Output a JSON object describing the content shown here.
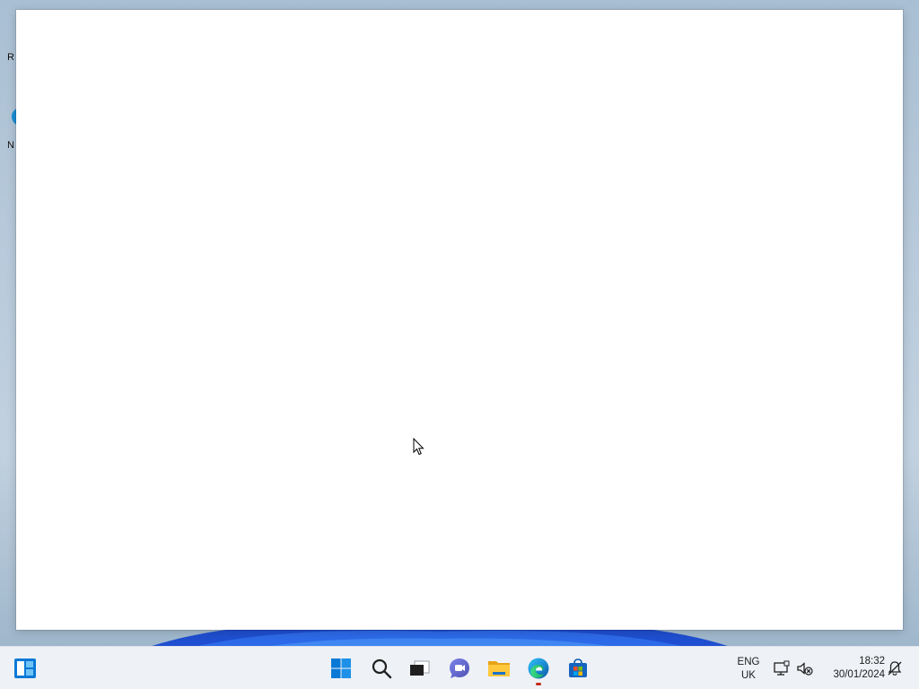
{
  "desktop": {
    "icon_fragments": [
      "R",
      "N"
    ]
  },
  "taskbar": {
    "widgets": {
      "icon": "widgets-icon"
    },
    "apps": [
      {
        "icon": "windows-start-icon",
        "label": "Start"
      },
      {
        "icon": "search-icon",
        "label": "Search"
      },
      {
        "icon": "task-view-icon",
        "label": "Task View"
      },
      {
        "icon": "chat-icon",
        "label": "Chat"
      },
      {
        "icon": "file-explorer-icon",
        "label": "File Explorer"
      },
      {
        "icon": "edge-icon",
        "label": "Microsoft Edge",
        "active": true
      },
      {
        "icon": "store-icon",
        "label": "Microsoft Store"
      }
    ],
    "language": {
      "line1": "ENG",
      "line2": "UK"
    },
    "tray": [
      {
        "icon": "network-icon"
      },
      {
        "icon": "volume-muted-icon"
      }
    ],
    "clock": {
      "time": "18:32",
      "date": "30/01/2024"
    },
    "notifications": {
      "icon": "notification-bell-icon"
    }
  },
  "colors": {
    "accent": "#0067c0",
    "taskbar_bg": "#eef1f6",
    "window_bg": "#ffffff",
    "active_indicator": "#c42b1c"
  }
}
